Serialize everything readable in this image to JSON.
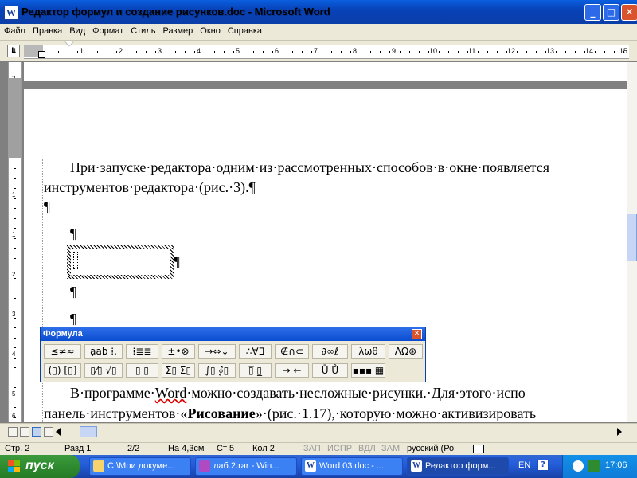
{
  "window": {
    "title": "Редактор формул и создание рисунков.doc - Microsoft Word",
    "app_icon_letter": "W",
    "min_glyph": "_",
    "max_glyph": "□",
    "close_glyph": "✕"
  },
  "menu": [
    "Файл",
    "Правка",
    "Вид",
    "Формат",
    "Стиль",
    "Размер",
    "Окно",
    "Справка"
  ],
  "ruler": {
    "tab_button": "L",
    "numbers": [
      "1",
      "1",
      "2",
      "3",
      "4",
      "5",
      "6",
      "7",
      "8",
      "9",
      "10",
      "11",
      "12",
      "13",
      "14",
      "15"
    ]
  },
  "vruler_numbers": [
    "2",
    "1",
    "1",
    "1",
    "2",
    "3",
    "4",
    "5",
    "6"
  ],
  "document": {
    "line1": "При·запуске·редактора·одним·из·рассмотренных·способов·в·окне·появляется",
    "line2": "инструментов·редактора·(рис.·3).¶",
    "pilcrow": "¶",
    "bottom1_a": "В·программе·",
    "bottom1_word": "Word",
    "bottom1_b": "·можно·создавать·несложные·рисунки.·Для·этого·испо",
    "bottom2_a": "панель·инструментов·«",
    "bottom2_bold": "Рисование",
    "bottom2_b": "»·(рис.·1.17),·которую·можно·активизировать"
  },
  "formula_toolbar": {
    "title": "Формула",
    "close_glyph": "✕",
    "row1": [
      "≤≠≈",
      "ạab ⁞.",
      "⁞≣≣",
      "±•⊗",
      "→⇔↓",
      "∴∀∃",
      "∉∩⊂",
      "∂∞ℓ",
      "λωθ",
      "ΛΩ⊛"
    ],
    "row2": [
      "(▯) [▯]",
      "▯⁄▯ √▯",
      "▯ ▯",
      "Σ▯ Σ▯",
      "∫▯ ∮▯",
      "▯̅ ▯̲",
      "→ ←",
      "Ū Ů",
      "▪▪▪ ▦"
    ]
  },
  "status": {
    "page": "Стр. 2",
    "section": "Разд 1",
    "pages": "2/2",
    "at": "На 4,3см",
    "line": "Ст 5",
    "col": "Кол 2",
    "rec": "ЗАП",
    "trk": "ИСПР",
    "ext": "ВДЛ",
    "ovr": "ЗАМ",
    "lang": "русский (Ро"
  },
  "taskbar": {
    "start_label": "пуск",
    "tasks": [
      "C:\\Мои докуме...",
      "лаб.2.rar - Win...",
      "Word 03.doc - ...",
      "Редактор форм..."
    ],
    "lang": "EN",
    "time": "17:06"
  }
}
